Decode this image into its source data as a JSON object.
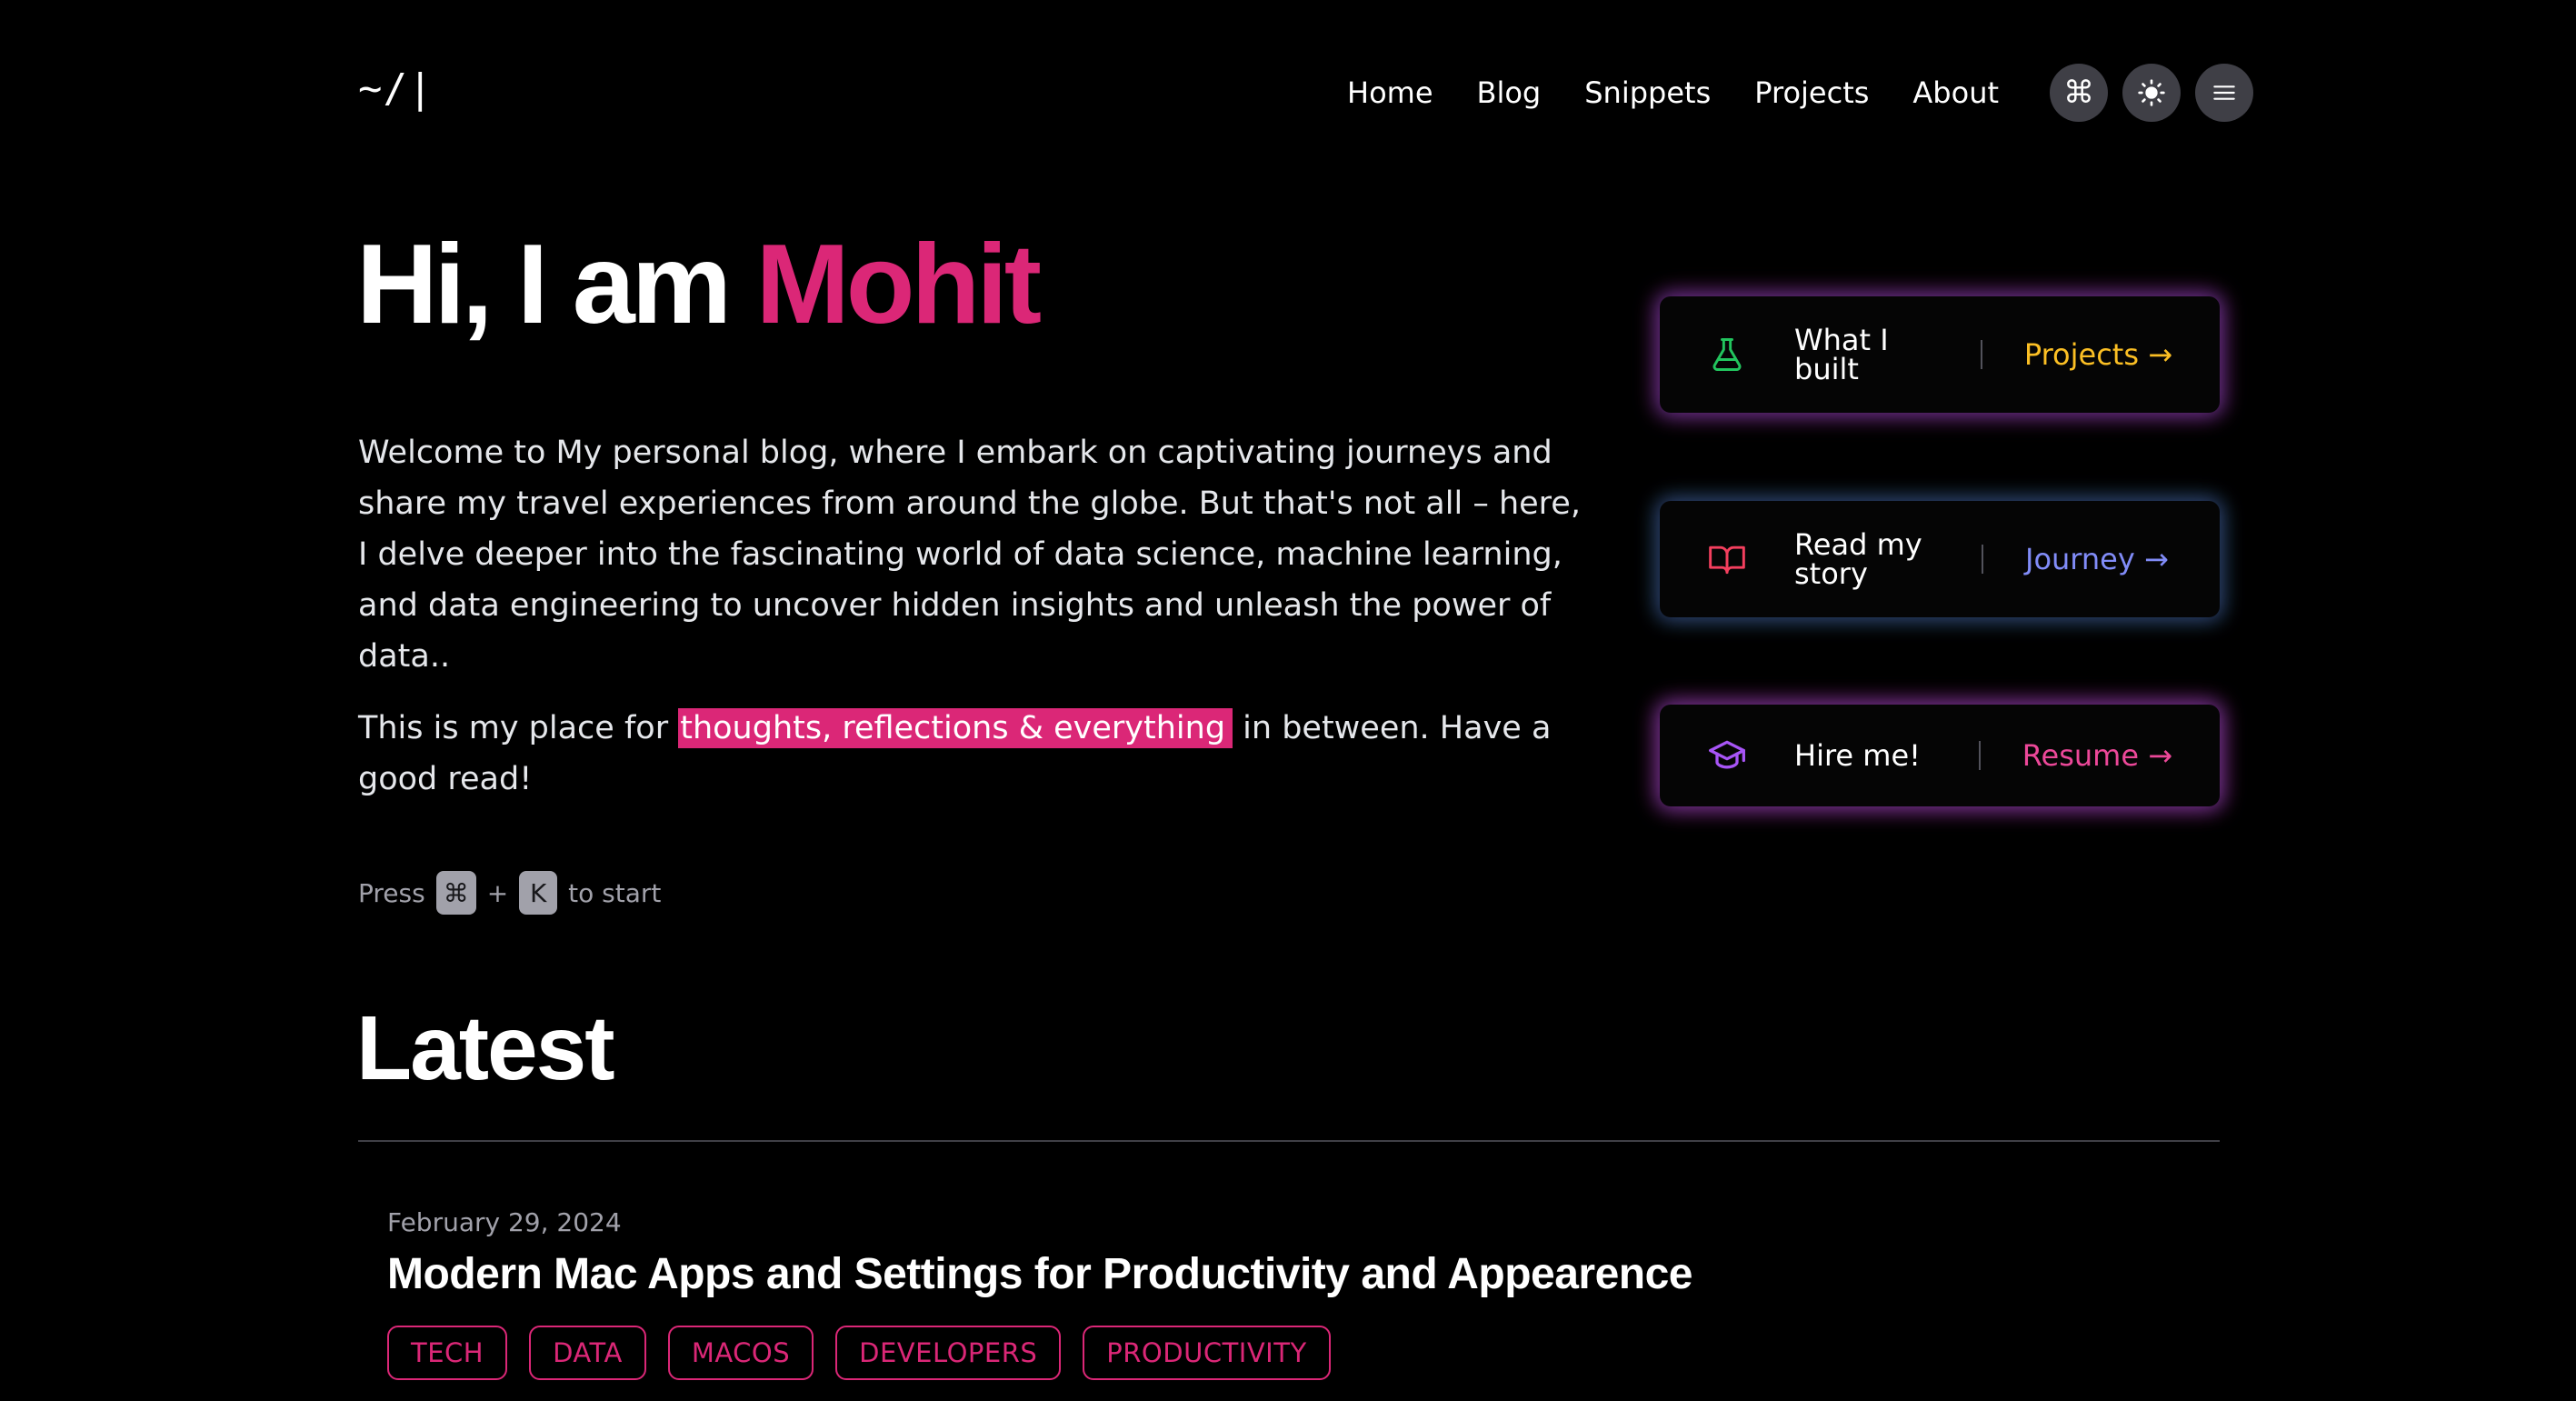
{
  "header": {
    "logo": "~/|",
    "nav": [
      "Home",
      "Blog",
      "Snippets",
      "Projects",
      "About"
    ],
    "icon_buttons": [
      "command-icon",
      "sun-icon",
      "menu-icon"
    ]
  },
  "hero": {
    "greeting": "Hi, I am ",
    "name": "Mohit",
    "intro": "Welcome to My personal blog, where I embark on captivating journeys and share my travel experiences from around the globe. But that's not all – here, I delve deeper into the fascinating world of data science, machine learning, and data engineering to uncover hidden insights and unleash the power of data..",
    "tagline_before": "This is my place for ",
    "tagline_highlight": "thoughts, reflections & everything",
    "tagline_after": " in between. Have a good read!",
    "press_label": "Press",
    "key_cmd": "⌘",
    "plus": "+",
    "key_k": "K",
    "press_suffix": "to start"
  },
  "cta_cards": [
    {
      "label": "What I built",
      "link": "Projects →",
      "icon": "flask-icon",
      "link_color": "#fbbf24"
    },
    {
      "label": "Read my story",
      "link": "Journey →",
      "icon": "book-icon",
      "link_color": "#818cf8"
    },
    {
      "label": "Hire me!",
      "link": "Resume →",
      "icon": "graduation-cap-icon",
      "link_color": "#ec4899"
    }
  ],
  "latest": {
    "heading": "Latest",
    "posts": [
      {
        "date": "February 29, 2024",
        "title": "Modern Mac Apps and Settings for Productivity and Appearence",
        "tags": [
          "TECH",
          "DATA",
          "MACOS",
          "DEVELOPERS",
          "PRODUCTIVITY"
        ]
      }
    ]
  },
  "colors": {
    "background": "#000000",
    "accent": "#db2777",
    "text": "#e5e7eb"
  }
}
